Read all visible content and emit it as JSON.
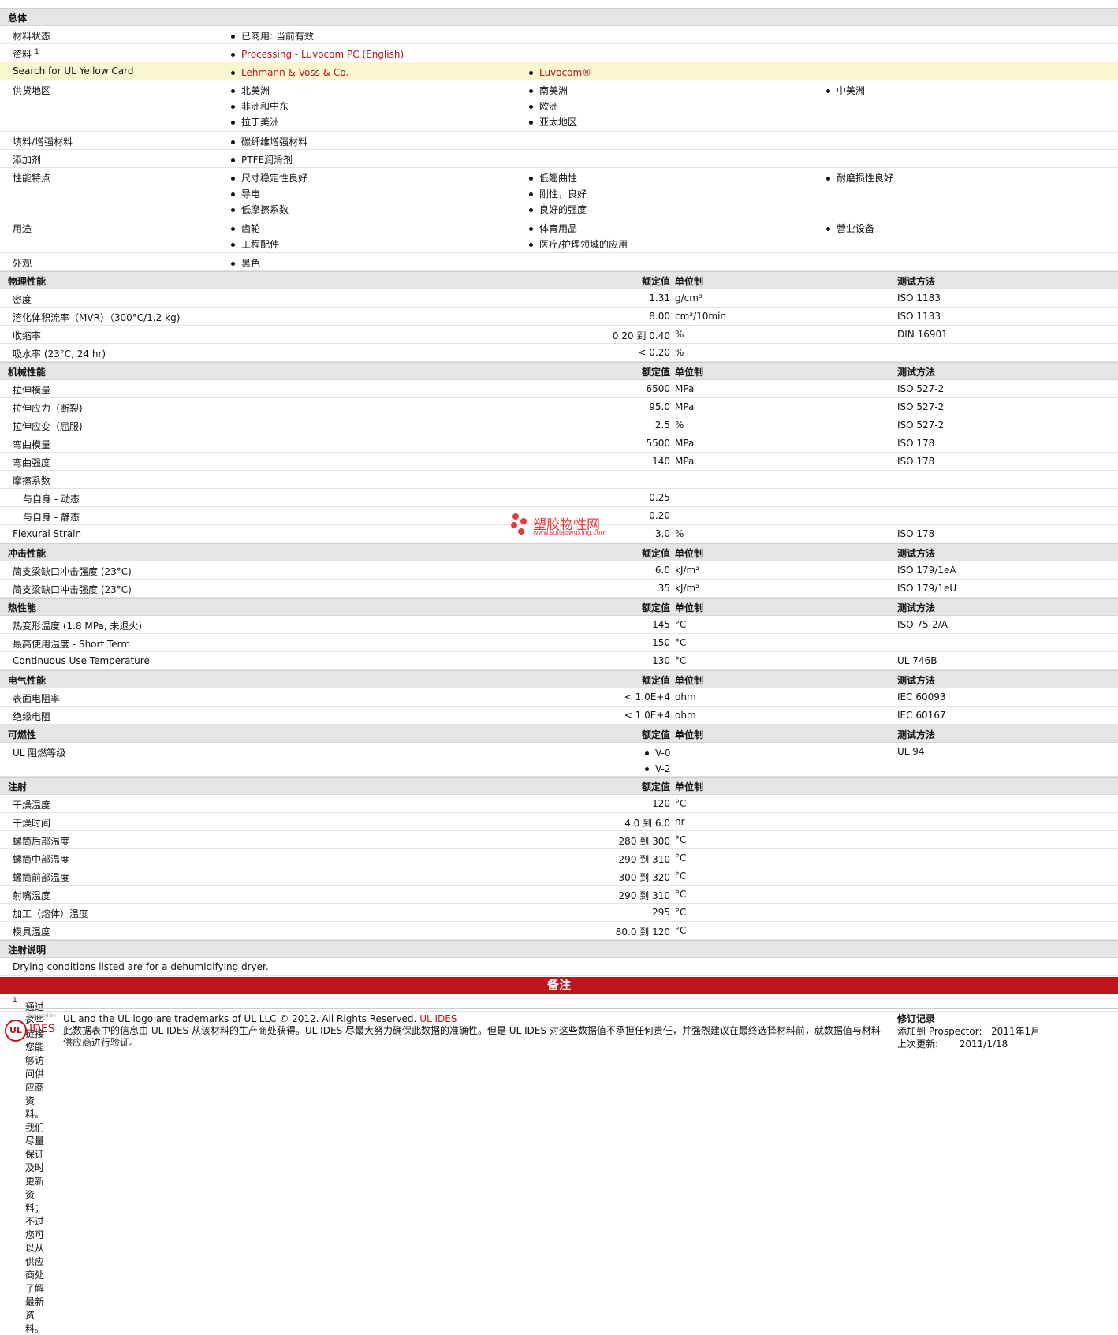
{
  "general": {
    "title": "总体",
    "material_status": {
      "label": "材料状态",
      "value": "已商用: 当前有效"
    },
    "documents": {
      "label": "资料",
      "sup": "1",
      "link": "Processing - Luvocom PC (English)"
    },
    "ul_card": {
      "label": "Search for UL Yellow Card",
      "links": [
        "Lehmann & Voss & Co.",
        "Luvocom®"
      ]
    },
    "regions": {
      "label": "供货地区",
      "col1": [
        "北美洲",
        "非洲和中东",
        "拉丁美洲"
      ],
      "col2": [
        "南美洲",
        "欧洲",
        "亚太地区"
      ],
      "col3": [
        "中美洲"
      ]
    },
    "filler": {
      "label": "填料/增强材料",
      "items": [
        "碳纤维增强材料"
      ]
    },
    "additive": {
      "label": "添加剂",
      "items": [
        "PTFE润滑剂"
      ]
    },
    "features": {
      "label": "性能特点",
      "col1": [
        "尺寸稳定性良好",
        "导电",
        "低摩擦系数"
      ],
      "col2": [
        "低翘曲性",
        "刚性，良好",
        "良好的强度"
      ],
      "col3": [
        "耐磨损性良好"
      ]
    },
    "uses": {
      "label": "用途",
      "col1": [
        "齿轮",
        "工程配件"
      ],
      "col2": [
        "体育用品",
        "医疗/护理领域的应用"
      ],
      "col3": [
        "营业设备"
      ]
    },
    "appearance": {
      "label": "外观",
      "items": [
        "黑色"
      ]
    }
  },
  "headers": {
    "value": "额定值",
    "unit": "单位制",
    "method": "测试方法"
  },
  "physical": {
    "title": "物理性能",
    "rows": [
      {
        "label": "密度",
        "value": "1.31",
        "unit": "g/cm³",
        "method": "ISO 1183"
      },
      {
        "label": "溶化体积流率（MVR）（300°C/1.2 kg)",
        "value": "8.00",
        "unit": "cm³/10min",
        "method": "ISO 1133"
      },
      {
        "label": "收缩率",
        "value": "0.20 到  0.40",
        "unit": "%",
        "method": "DIN 16901"
      },
      {
        "label": "吸水率 (23°C, 24 hr)",
        "value": "< 0.20",
        "unit": "%",
        "method": ""
      }
    ]
  },
  "mechanical": {
    "title": "机械性能",
    "rows": [
      {
        "label": "拉伸模量",
        "value": "6500",
        "unit": "MPa",
        "method": "ISO 527-2"
      },
      {
        "label": "拉伸应力（断裂)",
        "value": "95.0",
        "unit": "MPa",
        "method": "ISO 527-2"
      },
      {
        "label": "拉伸应变（屈服)",
        "value": "2.5",
        "unit": "%",
        "method": "ISO 527-2"
      },
      {
        "label": "弯曲模量",
        "value": "5500",
        "unit": "MPa",
        "method": "ISO 178"
      },
      {
        "label": "弯曲强度",
        "value": "140",
        "unit": "MPa",
        "method": "ISO 178"
      },
      {
        "label": "摩擦系数",
        "value": "",
        "unit": "",
        "method": ""
      },
      {
        "label": "与自身  - 动态",
        "value": "0.25",
        "unit": "",
        "method": "",
        "indent": true
      },
      {
        "label": "与自身  - 静态",
        "value": "0.20",
        "unit": "",
        "method": "",
        "indent": true
      },
      {
        "label": "Flexural Strain",
        "value": "3.0",
        "unit": "%",
        "method": "ISO 178"
      }
    ]
  },
  "impact": {
    "title": "冲击性能",
    "rows": [
      {
        "label": "简支梁缺口冲击强度 (23°C)",
        "value": "6.0",
        "unit": "kJ/m²",
        "method": "ISO 179/1eA"
      },
      {
        "label": "简支梁缺口冲击强度 (23°C)",
        "value": "35",
        "unit": "kJ/m²",
        "method": "ISO 179/1eU"
      }
    ]
  },
  "thermal": {
    "title": "热性能",
    "rows": [
      {
        "label": "热变形温度 (1.8 MPa, 未退火)",
        "value": "145",
        "unit": "°C",
        "method": "ISO 75-2/A"
      },
      {
        "label": "最高使用温度  - Short Term",
        "value": "150",
        "unit": "°C",
        "method": ""
      },
      {
        "label": "Continuous Use Temperature",
        "value": "130",
        "unit": "°C",
        "method": "UL 746B"
      }
    ]
  },
  "electrical": {
    "title": "电气性能",
    "rows": [
      {
        "label": "表面电阻率",
        "value": "< 1.0E+4",
        "unit": "ohm",
        "method": "IEC 60093"
      },
      {
        "label": "绝缘电阻",
        "value": "< 1.0E+4",
        "unit": "ohm",
        "method": "IEC 60167"
      }
    ]
  },
  "flammability": {
    "title": "可燃性",
    "label": "UL 阻燃等级",
    "values": [
      "V-0",
      "V-2"
    ],
    "method": "UL 94"
  },
  "injection": {
    "title": "注射",
    "rows": [
      {
        "label": "干燥温度",
        "value": "120",
        "unit": "°C"
      },
      {
        "label": "干燥时间",
        "value": "4.0 到  6.0",
        "unit": "hr"
      },
      {
        "label": "螺筒后部温度",
        "value": "280 到  300",
        "unit": "°C"
      },
      {
        "label": "螺筒中部温度",
        "value": "290 到  310",
        "unit": "°C"
      },
      {
        "label": "螺筒前部温度",
        "value": "300 到  320",
        "unit": "°C"
      },
      {
        "label": "射嘴温度",
        "value": "290 到  310",
        "unit": "°C"
      },
      {
        "label": "加工（熔体）温度",
        "value": "295",
        "unit": "°C"
      },
      {
        "label": "模具温度",
        "value": "80.0 到  120",
        "unit": "°C"
      }
    ]
  },
  "injection_notes": {
    "title": "注射说明",
    "text": "Drying conditions listed are for a dehumidifying dryer."
  },
  "notes": {
    "title": "备注",
    "sup": "1",
    "text": "通过这些链接您能够访问供应商资料。我们尽量保证及时更新资料；不过您可以从供应商处了解最新资料。"
  },
  "footer": {
    "trademark": "UL and the UL logo are trademarks of UL LLC © 2012. All Rights Reserved.",
    "trademark_link": "UL IDES",
    "disclaimer": "此数据表中的信息由  UL IDES 从该材料的生产商处获得。UL IDES 尽最大努力确保此数据的准确性。但是  UL IDES 对这些数据值不承担任何责任，并强烈建议在最终选择材料前，就数据值与材料供应商进行验证。",
    "logo_small": "Powered by",
    "logo_ul": "UL",
    "logo_ides": "IDES",
    "rev_title": "修订记录",
    "rev_added_label": "添加到  Prospector:",
    "rev_added_value": "2011年1月",
    "rev_updated_label": "上次更新:",
    "rev_updated_value": "2011/1/18"
  },
  "watermark": {
    "text": "塑胶物性网",
    "url": "www.sujiaowuxing.com"
  },
  "colors": {
    "accent_red": "#c0161b",
    "link_red": "#b3161b",
    "highlight": "#fbf6cf",
    "section_bg": "#e5e5e5"
  }
}
